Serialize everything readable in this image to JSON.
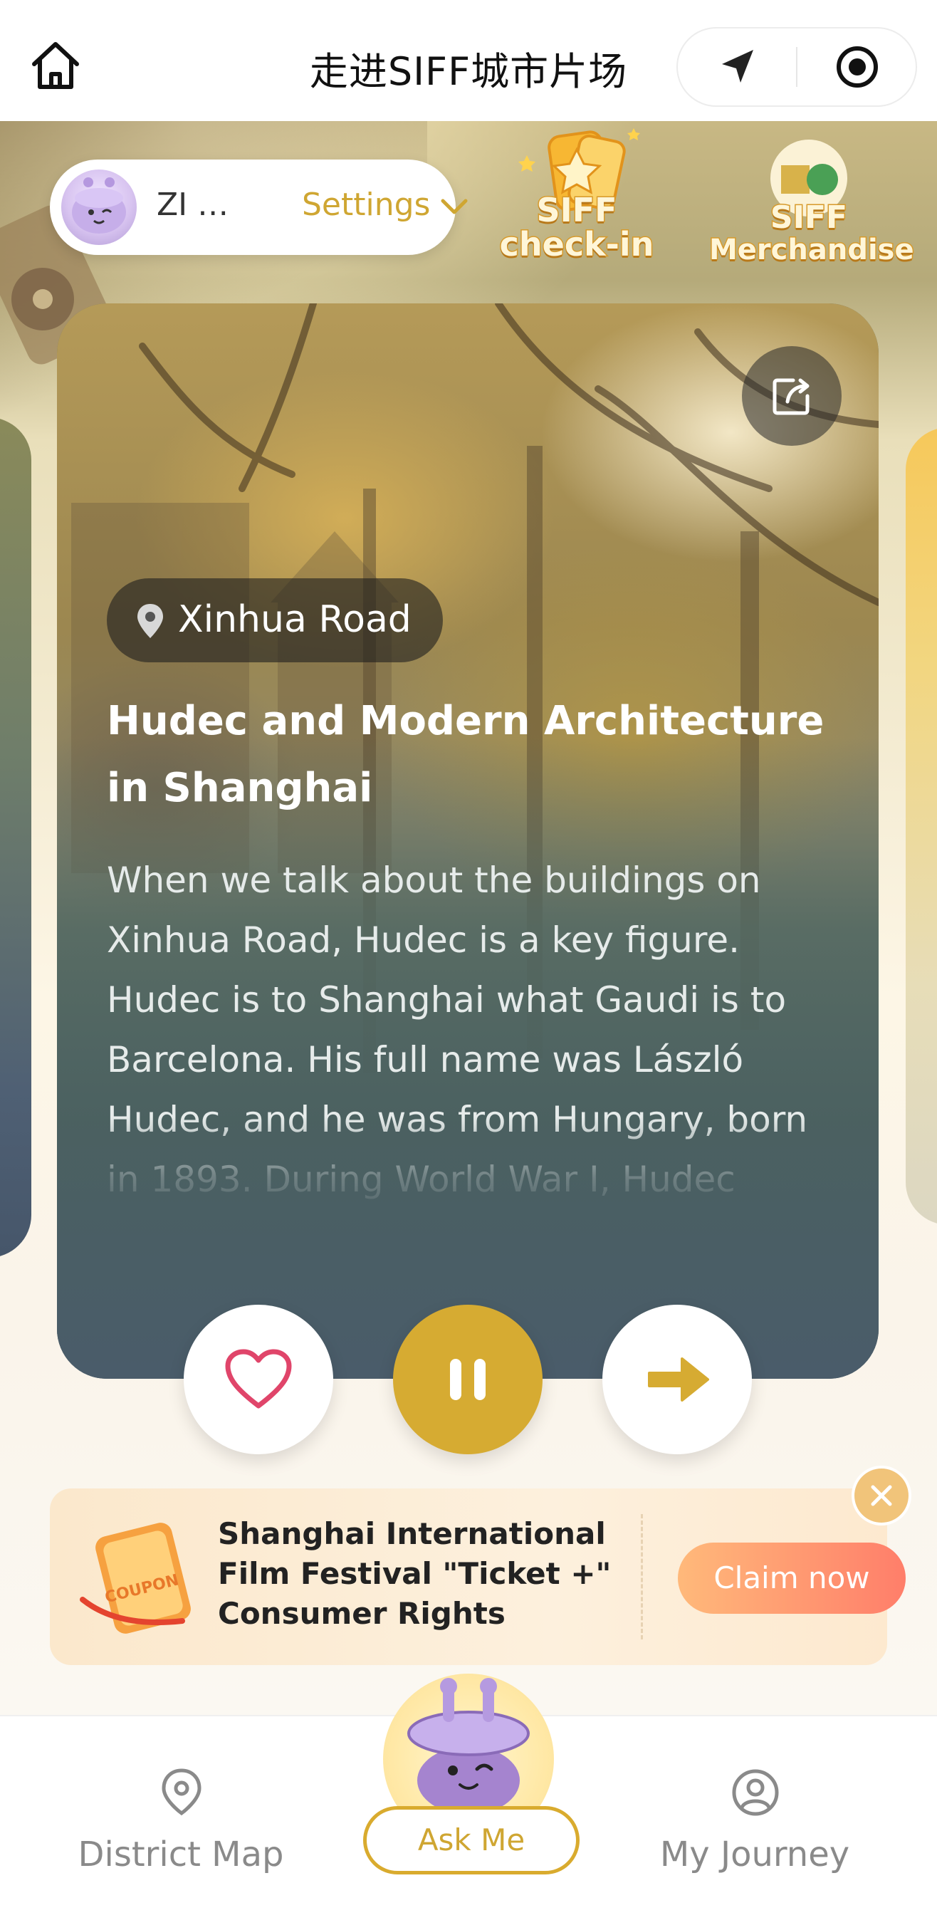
{
  "header": {
    "title": "走进SIFF城市片场"
  },
  "user": {
    "name": "ZI …",
    "settings_label": "Settings"
  },
  "badges": {
    "checkin_label": "SIFF check-in",
    "checkin_line1": "SIFF",
    "checkin_line2": "check-in",
    "merch_line1": "SIFF",
    "merch_line2": "Merchandise"
  },
  "card": {
    "location": "Xinhua Road",
    "title": "Hudec and Modern Architecture in Shanghai",
    "body": "When we talk about the buildings on Xinhua Road, Hudec is a key figure. Hudec is to Shanghai what Gaudi is to Barcelona. His full name was László Hudec, and he was from Hungary, born in 1893. During World War I, Hudec became a prisoner of war and …"
  },
  "promo": {
    "text": "Shanghai International Film Festival \"Ticket +\" Consumer Rights",
    "claim_label": "Claim now",
    "coupon_text": "COUPON"
  },
  "nav": {
    "map_label": "District Map",
    "ask_label": "Ask Me",
    "journey_label": "My Journey"
  },
  "colors": {
    "accent": "#d6ab32",
    "settings_text": "#cfa632",
    "claim_start": "#ffb97a",
    "claim_end": "#ff7e6a",
    "like_heart": "#e0456a"
  },
  "icons": {
    "home": "home-icon",
    "navigate": "navigation-arrow-icon",
    "record": "target-record-icon",
    "share": "share-icon",
    "location": "location-pin-icon",
    "like": "heart-icon",
    "pause": "pause-icon",
    "next": "arrow-right-icon",
    "close": "close-icon",
    "map": "map-pin-icon",
    "journey": "user-circle-icon"
  },
  "playback": {
    "state": "playing"
  }
}
